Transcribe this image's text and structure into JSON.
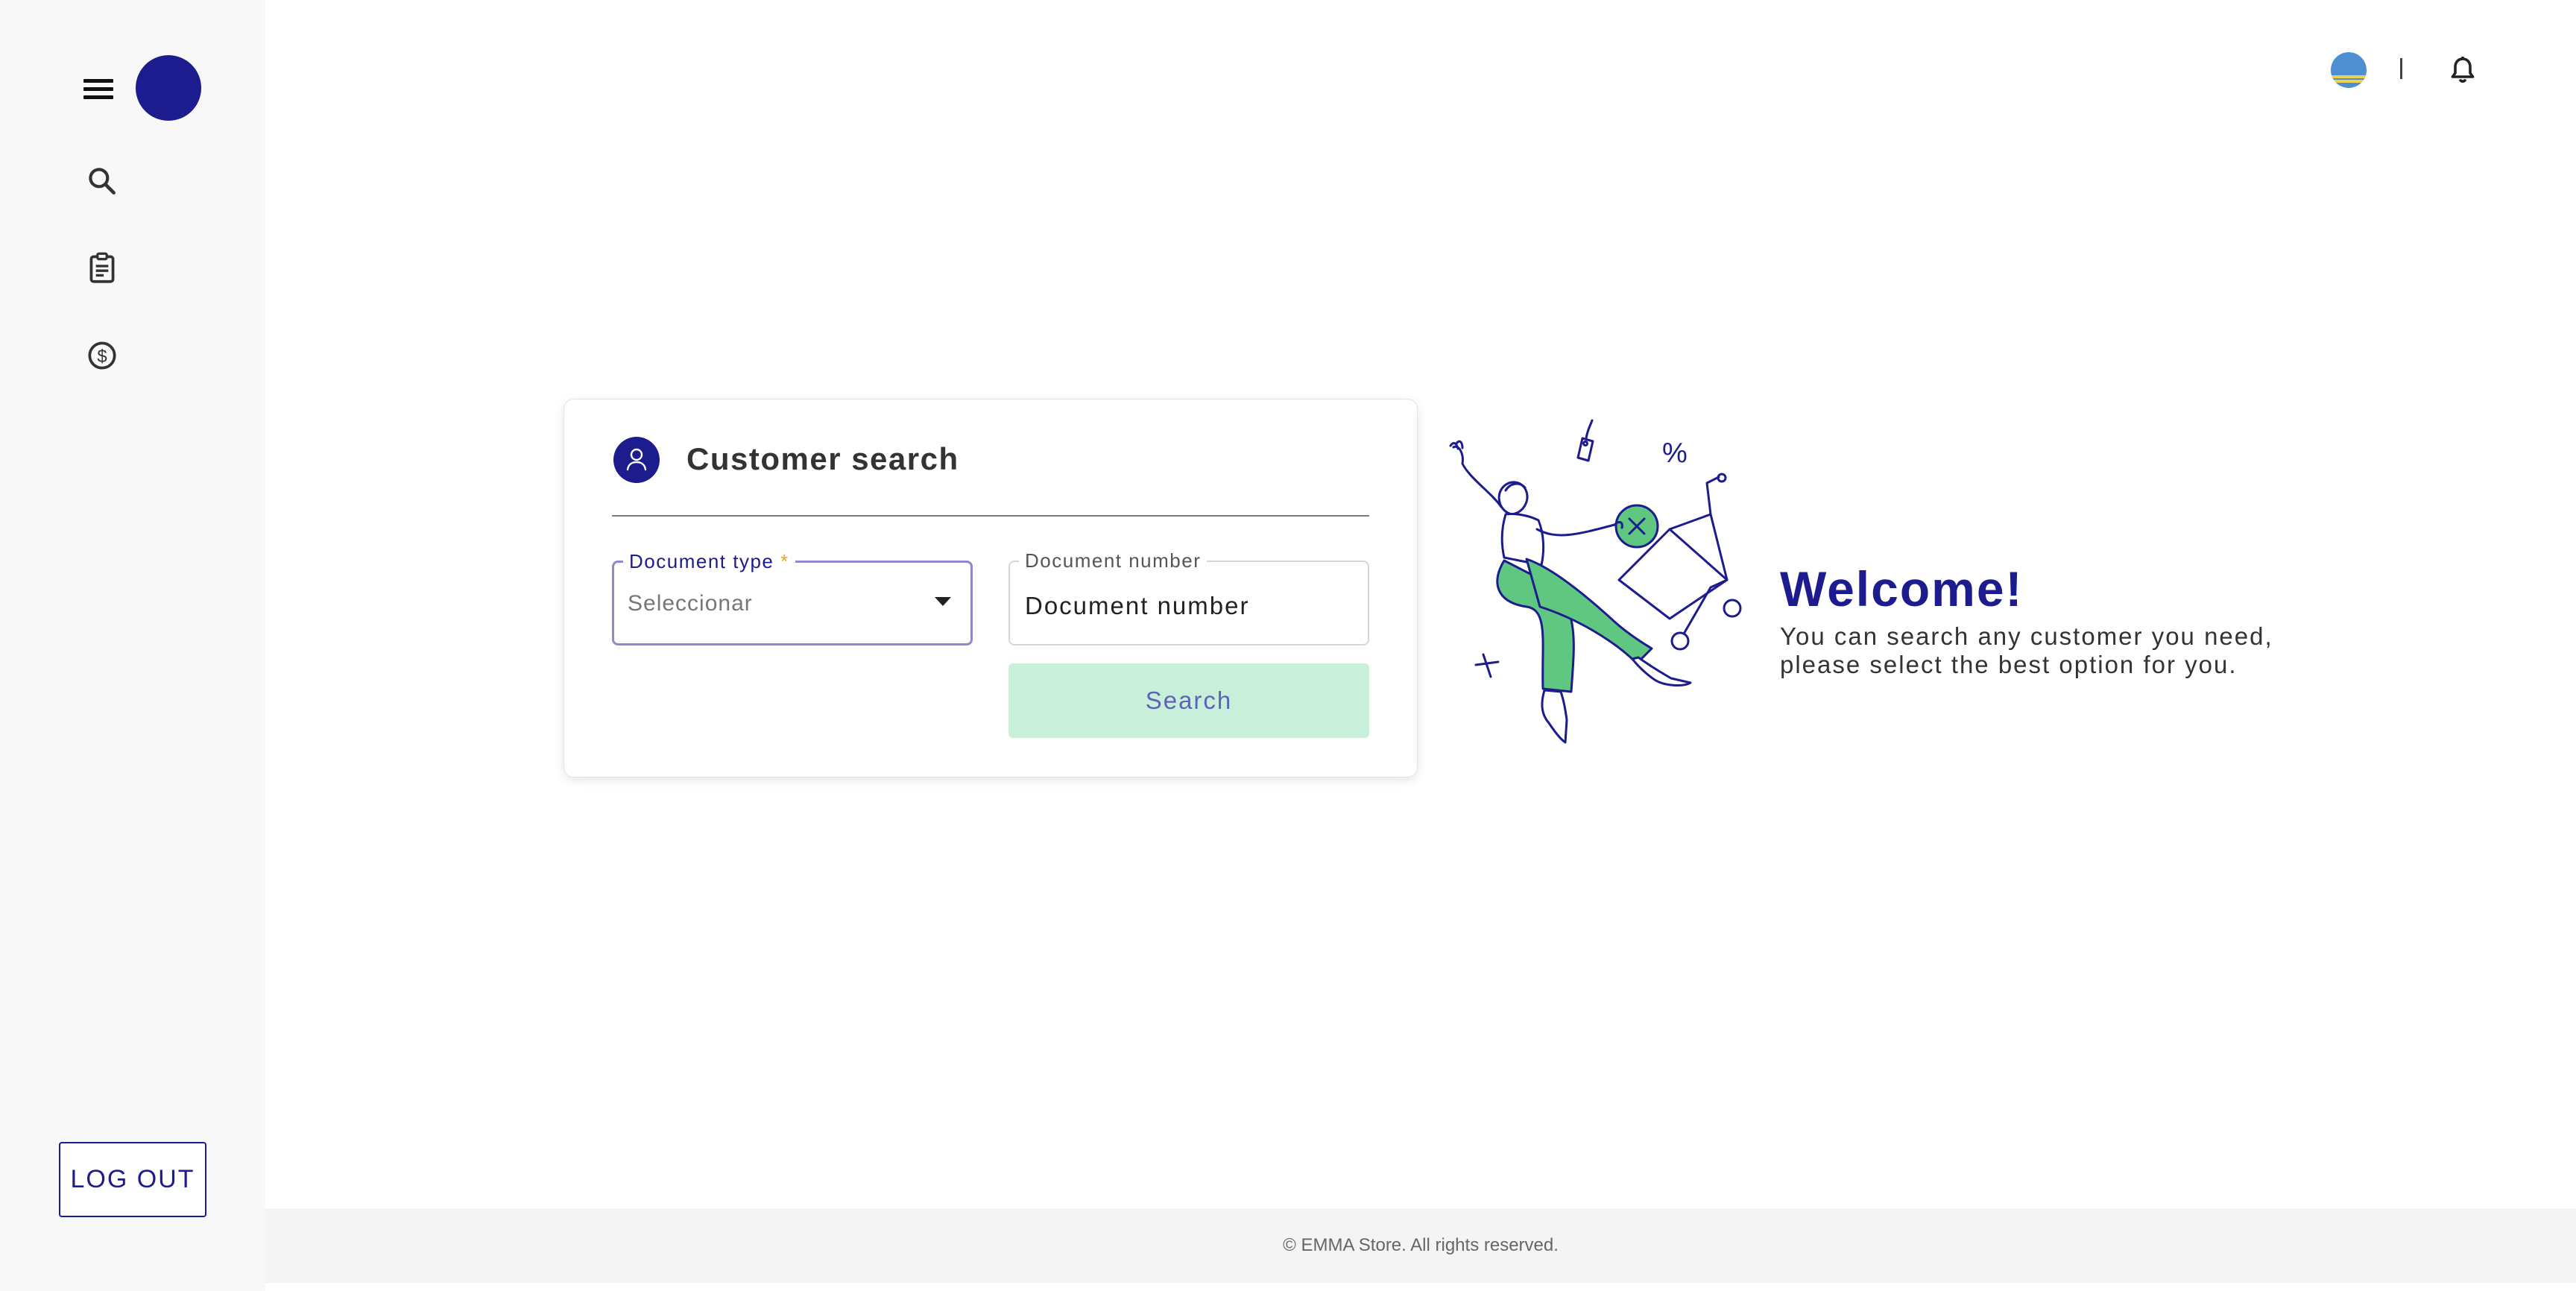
{
  "sidebar": {
    "menu_icon": "hamburger-menu-icon",
    "avatar": "user-avatar",
    "nav": [
      {
        "icon": "search-icon"
      },
      {
        "icon": "clipboard-icon"
      },
      {
        "icon": "dollar-coin-icon"
      }
    ],
    "logout_label": "LOG OUT"
  },
  "topbar": {
    "flag_icon": "country-flag-icon",
    "separator": "|",
    "bell_icon": "notification-bell-icon"
  },
  "search_card": {
    "title": "Customer search",
    "icon": "person-icon",
    "document_type": {
      "label": "Document type",
      "required_mark": "*",
      "value": "Seleccionar"
    },
    "document_number": {
      "label": "Document number",
      "value": "Document number"
    },
    "search_label": "Search"
  },
  "welcome": {
    "title": "Welcome!",
    "line1": "You can search any customer you need,",
    "line2": "please select the best option for you."
  },
  "footer": {
    "text": "© EMMA Store. All rights reserved."
  },
  "colors": {
    "primary": "#1c1c8f",
    "accent_green": "#5fc77f",
    "button_bg": "#c8efda",
    "sidebar_bg": "#f8f8f8",
    "footer_bg": "#f4f4f4"
  }
}
